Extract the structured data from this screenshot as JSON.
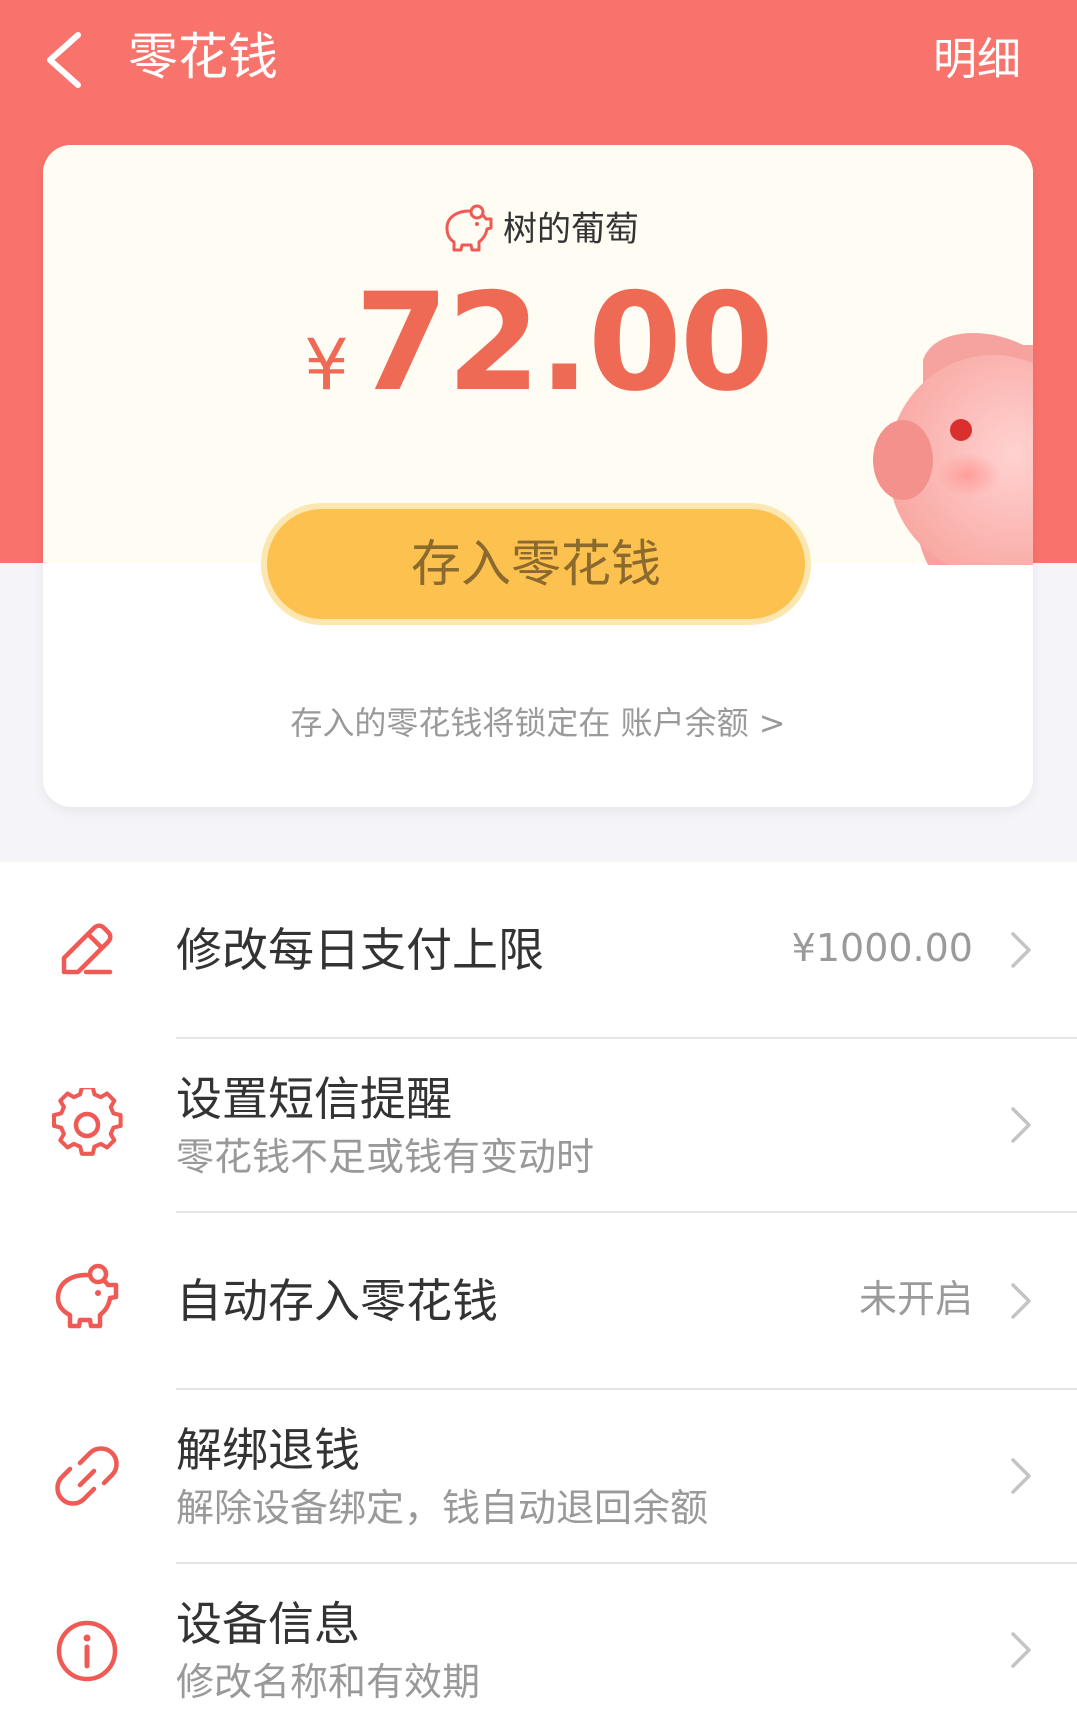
{
  "header": {
    "title": "零花钱",
    "detail_label": "明细"
  },
  "card": {
    "owner_name": "树的葡萄",
    "currency_symbol": "¥",
    "amount": "72.00",
    "deposit_button": "存入零花钱",
    "note_text": "存入的零花钱将锁定在",
    "note_link": "账户余额 >"
  },
  "settings": [
    {
      "label": "修改每日支付上限",
      "value": "¥1000.00",
      "icon": "edit-icon"
    },
    {
      "label": "设置短信提醒",
      "sub": "零花钱不足或钱有变动时",
      "icon": "gear-icon"
    },
    {
      "label": "自动存入零花钱",
      "value": "未开启",
      "icon": "piggy-bank-icon"
    },
    {
      "label": "解绑退钱",
      "sub": "解除设备绑定，钱自动退回余额",
      "icon": "unlink-icon"
    },
    {
      "label": "设备信息",
      "sub": "修改名称和有效期",
      "icon": "info-icon"
    }
  ],
  "colors": {
    "brand": "#f8736c",
    "accent_button": "#fcc14f",
    "amount": "#ef6a55",
    "icon": "#ef5a55"
  }
}
